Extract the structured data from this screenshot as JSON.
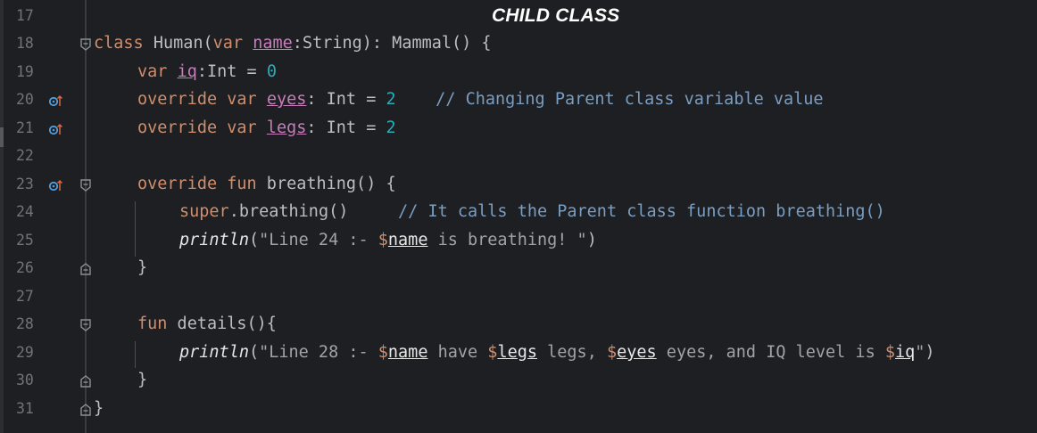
{
  "title": "CHILD CLASS",
  "lines": [
    {
      "n": "17"
    },
    {
      "n": "18",
      "c": [
        "class",
        " Human(",
        "var",
        " ",
        "name",
        ":String): Mammal() {"
      ]
    },
    {
      "n": "19",
      "c": [
        "var",
        " ",
        "iq",
        ":Int = ",
        "0"
      ]
    },
    {
      "n": "20",
      "c": [
        "override",
        " ",
        "var",
        " ",
        "eyes",
        ": Int = ",
        "2",
        "    // Changing Parent class variable value"
      ]
    },
    {
      "n": "21",
      "c": [
        "override",
        " ",
        "var",
        " ",
        "legs",
        ": Int = ",
        "2"
      ]
    },
    {
      "n": "22"
    },
    {
      "n": "23",
      "c": [
        "override",
        " ",
        "fun",
        " breathing() {"
      ]
    },
    {
      "n": "24",
      "c": [
        "super",
        ".breathing()",
        "     // It calls the Parent class function breathing()"
      ]
    },
    {
      "n": "25",
      "c": [
        "println",
        "(",
        "\"Line 24 :- ",
        "$",
        "name",
        " is breathing! \"",
        ")"
      ]
    },
    {
      "n": "26",
      "c": [
        "}"
      ]
    },
    {
      "n": "27"
    },
    {
      "n": "28",
      "c": [
        "fun",
        " details(){"
      ]
    },
    {
      "n": "29",
      "c": [
        "println",
        "(",
        "\"Line 28 :- ",
        "$",
        "name",
        " have ",
        "$",
        "legs",
        " legs, ",
        "$",
        "eyes",
        " eyes, and IQ level is ",
        "$",
        "iq",
        "\"",
        ")"
      ]
    },
    {
      "n": "30",
      "c": [
        "}"
      ]
    },
    {
      "n": "31",
      "c": [
        "}"
      ]
    }
  ],
  "icons": {
    "override": "override-up-icon",
    "fold_open": "fold-open-icon",
    "fold_close": "fold-close-icon"
  },
  "colors": {
    "background": "#1e1f22",
    "keyword": "#cf8e6d",
    "number": "#2aacb8",
    "string": "#6aab73",
    "comment": "#7a9ec2",
    "line_number": "#6f737a"
  }
}
